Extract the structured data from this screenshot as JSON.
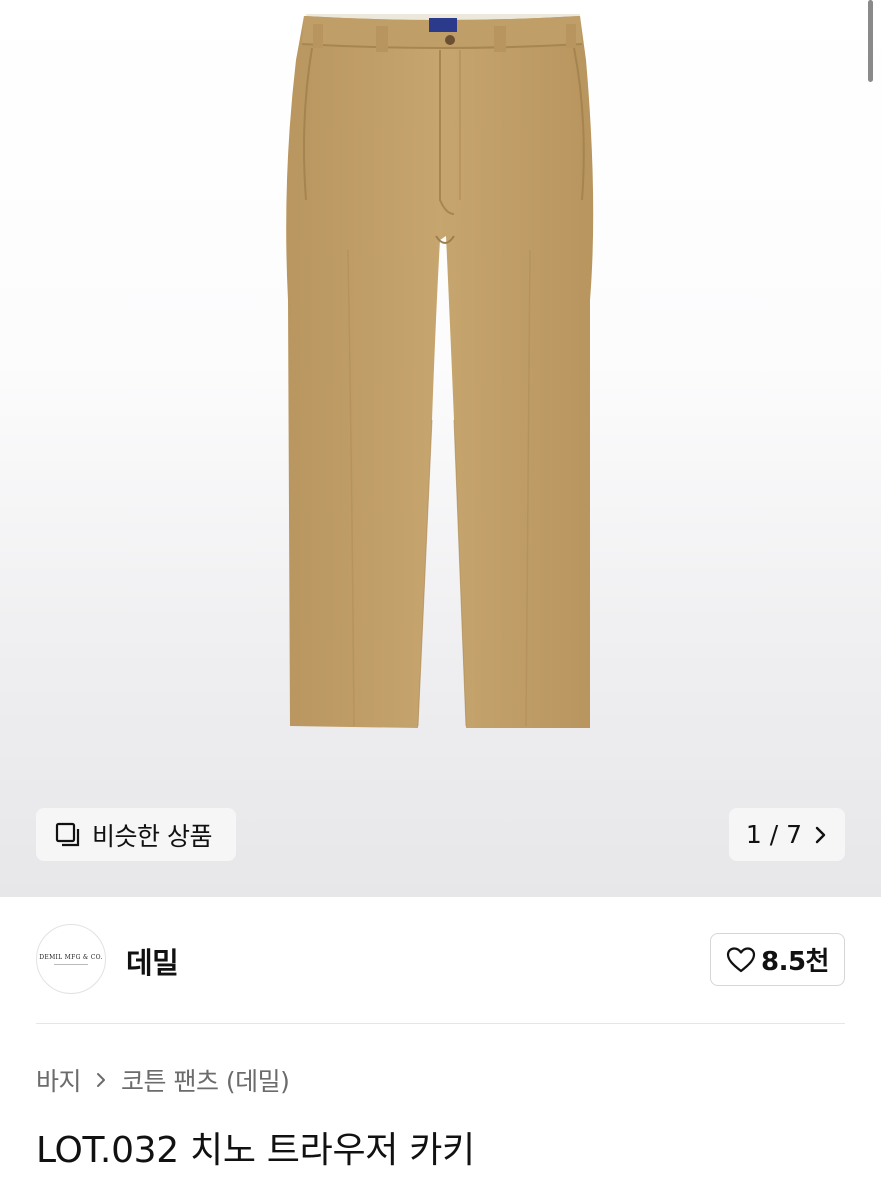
{
  "product_image": {
    "description_icon": "product-photo",
    "fabric_color": "#c4a36d",
    "counter_current": "1",
    "counter_total": "7",
    "counter_text": "1 / 7"
  },
  "similar_button": {
    "label": "비슷한 상품",
    "icon": "stacked-squares-icon"
  },
  "brand": {
    "name": "데밀",
    "logo_text": "DEMIL MFG & CO.",
    "like_count": "8.5천",
    "like_icon": "heart-outline-icon"
  },
  "breadcrumb": {
    "category": "바지",
    "subcategory": "코튼 팬츠 (데밀)"
  },
  "product": {
    "title": "LOT.032 치노 트라우저 카키"
  },
  "colors": {
    "button_bg": "#f6f6f7",
    "text_primary": "#111111",
    "text_secondary": "#6b6b6b",
    "border": "#d6d6d6"
  }
}
